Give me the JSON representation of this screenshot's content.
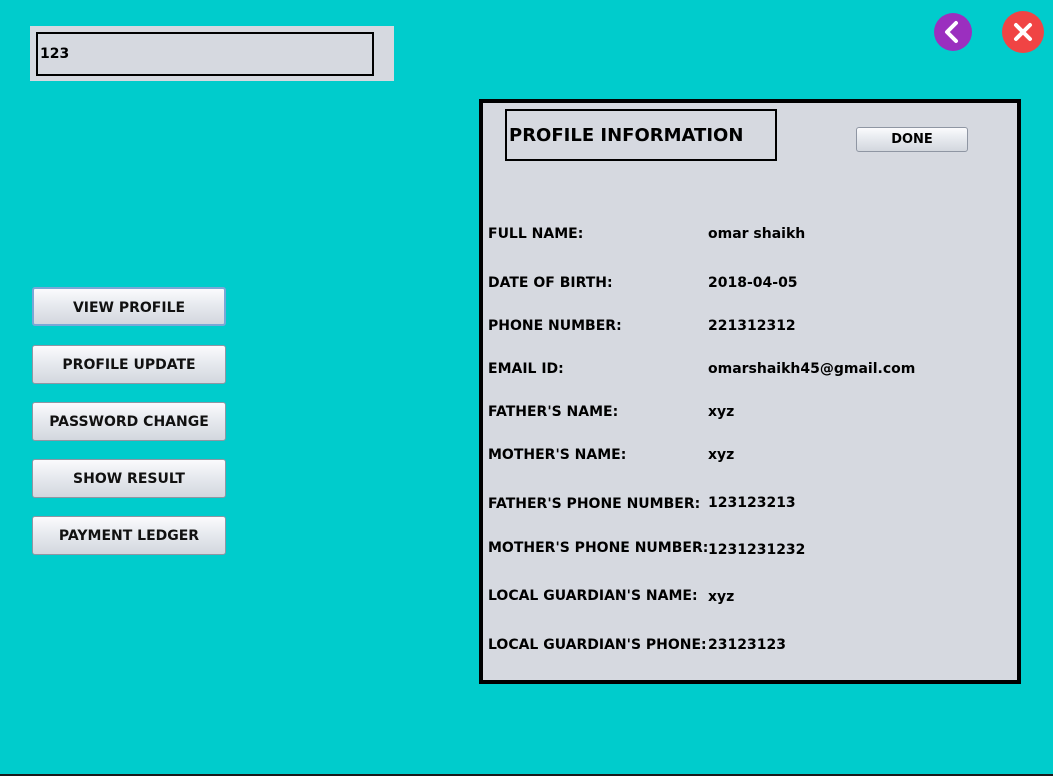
{
  "top_field": {
    "value": "123"
  },
  "window_controls": {
    "back_icon": "chevron-left-icon",
    "close_icon": "close-x-icon",
    "back_color": "#9b2fbf",
    "close_color": "#f04444"
  },
  "sidebar": {
    "items": [
      {
        "label": "VIEW PROFILE"
      },
      {
        "label": "PROFILE UPDATE"
      },
      {
        "label": "PASSWORD CHANGE"
      },
      {
        "label": "SHOW RESULT"
      },
      {
        "label": "PAYMENT LEDGER"
      }
    ]
  },
  "profile": {
    "title": "PROFILE INFORMATION",
    "done_label": "DONE",
    "rows": [
      {
        "label": "FULL NAME:",
        "value": "omar shaikh"
      },
      {
        "label": "DATE OF BIRTH:",
        "value": "2018-04-05"
      },
      {
        "label": "PHONE NUMBER:",
        "value": "221312312"
      },
      {
        "label": "EMAIL ID:",
        "value": "omarshaikh45@gmail.com"
      },
      {
        "label": "FATHER'S NAME:",
        "value": "xyz"
      },
      {
        "label": "MOTHER'S NAME:",
        "value": "xyz"
      },
      {
        "label": "FATHER'S PHONE NUMBER:",
        "value": "123123213"
      },
      {
        "label": "MOTHER'S PHONE NUMBER:",
        "value": "1231231232"
      },
      {
        "label": "LOCAL GUARDIAN'S NAME:",
        "value": "xyz"
      },
      {
        "label": "LOCAL GUARDIAN'S PHONE:",
        "value": "23123123"
      }
    ]
  },
  "colors": {
    "background": "#00cccc",
    "panel": "#d6d9e0"
  }
}
